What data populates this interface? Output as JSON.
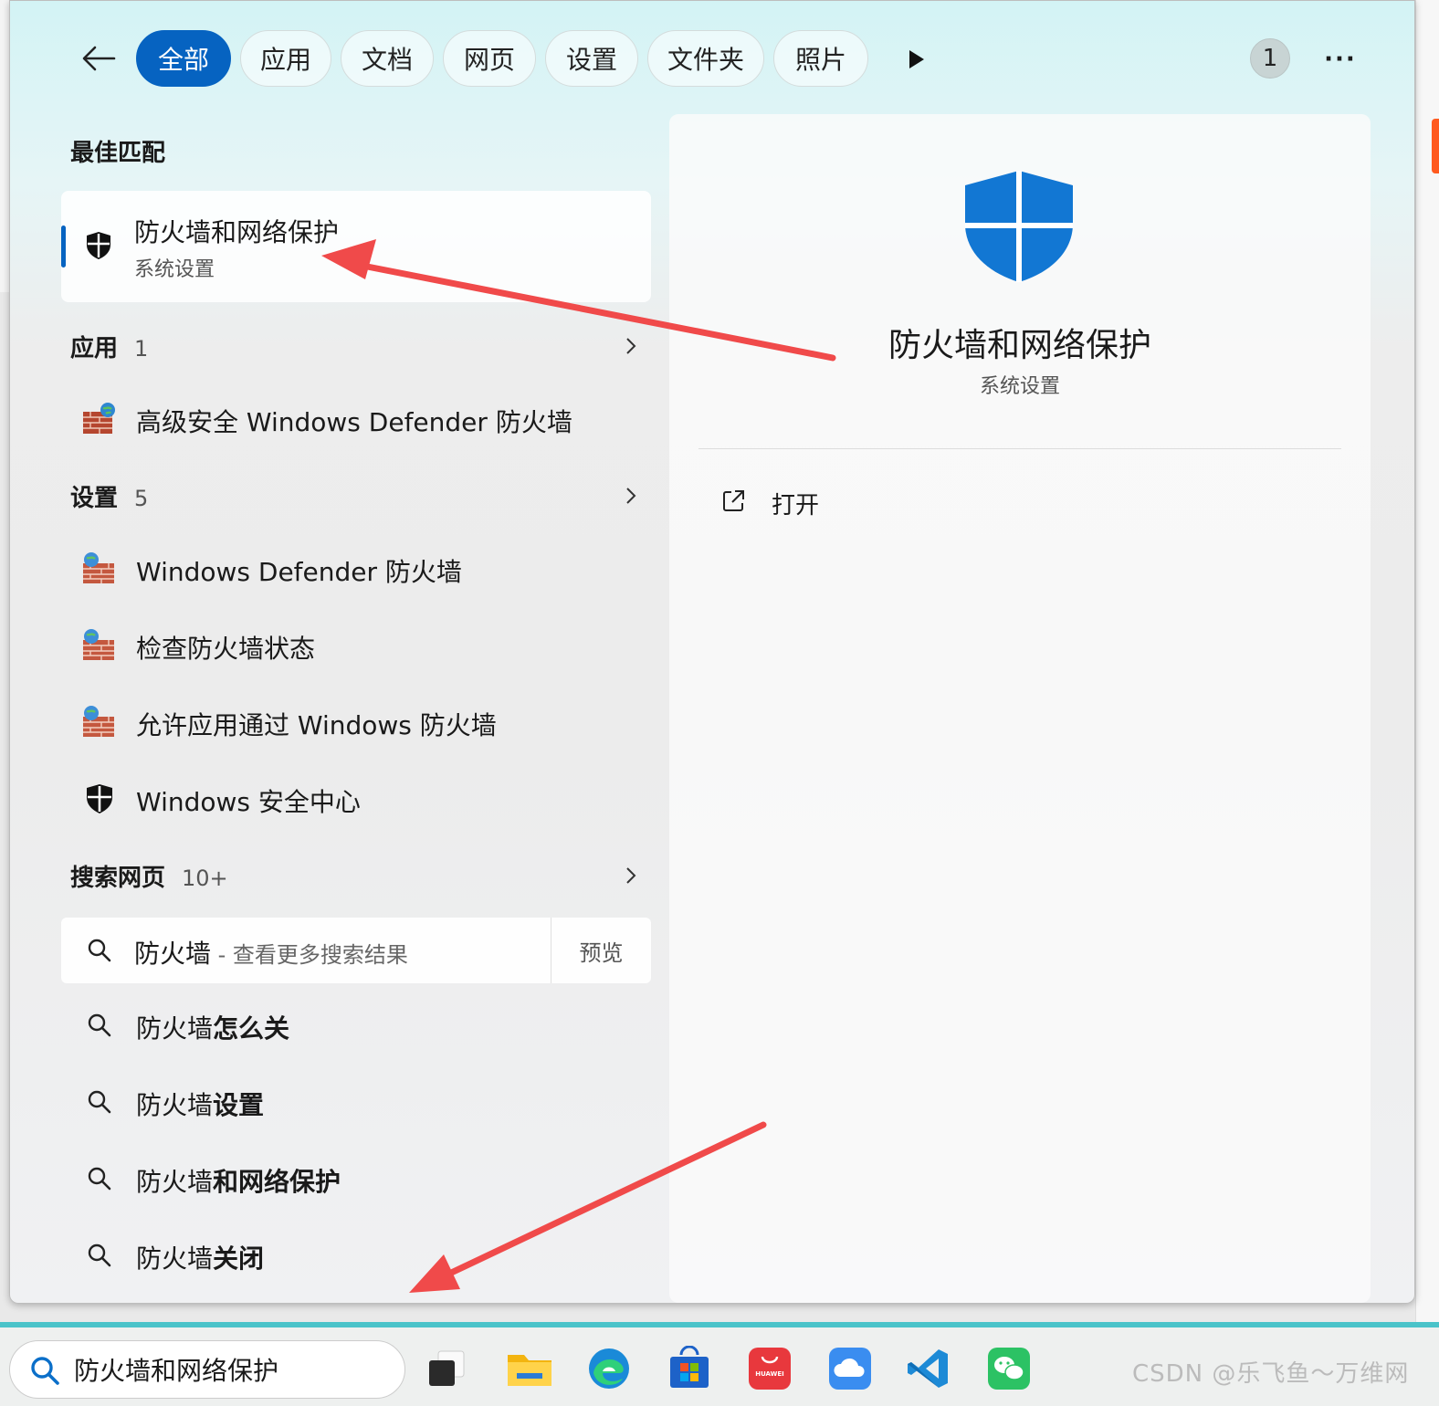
{
  "tabs": [
    {
      "label": "全部",
      "active": true
    },
    {
      "label": "应用"
    },
    {
      "label": "文档"
    },
    {
      "label": "网页"
    },
    {
      "label": "设置"
    },
    {
      "label": "文件夹"
    },
    {
      "label": "照片"
    }
  ],
  "topbar": {
    "badge": "1",
    "more": "···"
  },
  "best_match": {
    "heading": "最佳匹配",
    "title": "防火墙和网络保护",
    "subtitle": "系统设置"
  },
  "apps": {
    "heading": "应用",
    "count": "1",
    "items": [
      "高级安全 Windows Defender 防火墙"
    ]
  },
  "settings": {
    "heading": "设置",
    "count": "5",
    "items": [
      "Windows Defender 防火墙",
      "检查防火墙状态",
      "允许应用通过 Windows 防火墙",
      "Windows 安全中心"
    ]
  },
  "web": {
    "heading": "搜索网页",
    "count": "10+",
    "main_query": "防火墙",
    "main_suffix": " - 查看更多搜索结果",
    "preview": "预览",
    "suggestions": [
      {
        "prefix": "防火墙",
        "bold": "怎么关"
      },
      {
        "prefix": "防火墙",
        "bold": "设置"
      },
      {
        "prefix": "防火墙",
        "bold": "和网络保护"
      },
      {
        "prefix": "防火墙",
        "bold": "关闭"
      }
    ]
  },
  "preview_pane": {
    "title": "防火墙和网络保护",
    "subtitle": "系统设置",
    "action_open": "打开"
  },
  "taskbar": {
    "search_value": "防火墙和网络保护",
    "apps": [
      "task-view",
      "file-explorer",
      "edge",
      "microsoft-store",
      "huawei-appgallery",
      "cloud",
      "vscode",
      "wechat"
    ],
    "huawei_label": "HUAWEI",
    "watermark": "CSDN @乐飞鱼～万维网"
  },
  "colors": {
    "accent": "#0663c1",
    "annotation_arrow": "#f04a4a",
    "shield": "#1277d3"
  }
}
